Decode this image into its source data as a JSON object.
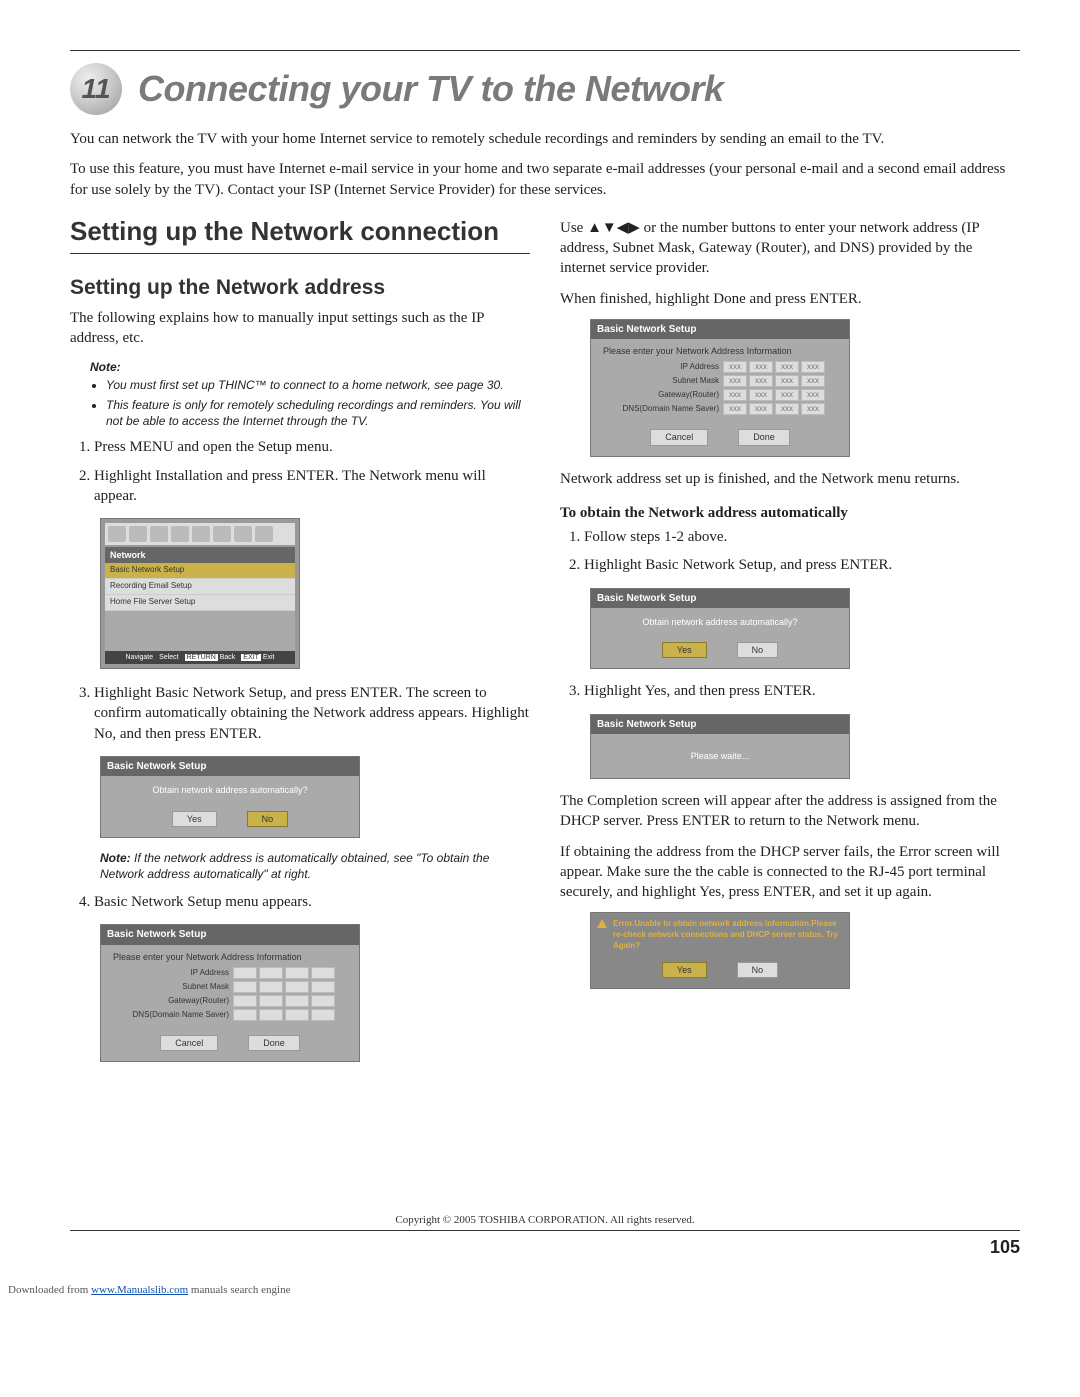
{
  "chapter": {
    "number": "11",
    "title": "Connecting your TV to the Network"
  },
  "intro": {
    "p1": "You can network the TV with your home Internet service to remotely schedule recordings and reminders by sending an email to the TV.",
    "p2": "To use this feature, you must have Internet e-mail service in your home and two separate e-mail addresses (your personal e-mail and a second email address for use solely by the TV). Contact your ISP (Internet Service Provider) for these services."
  },
  "left": {
    "h1": "Setting up the Network connection",
    "h2": "Setting up the Network address",
    "p_lead": "The following explains how to manually input settings such as the IP address, etc.",
    "note_label": "Note:",
    "note_items": [
      "You must first set up THINC™ to connect to a home network, see page 30.",
      "This feature is only for remotely scheduling recordings and reminders. You will not be able to access the Internet through the TV."
    ],
    "ol1": "Press MENU and open the Setup menu.",
    "ol2": "Highlight Installation and press ENTER. The Network menu will appear.",
    "ol3": "Highlight Basic Network Setup, and press ENTER. The screen to confirm automatically obtaining the Network address appears. Highlight No, and then press ENTER.",
    "inline_note_label": "Note:",
    "inline_note": " If the network address is automatically obtained, see \"To obtain the Network address automatically\" at right.",
    "ol4": "Basic Network Setup menu appears."
  },
  "right": {
    "p1": "Use ▲▼◀▶ or the number buttons to enter your network address (IP address, Subnet Mask, Gateway (Router), and DNS) provided by the internet service provider.",
    "p2": "When finished, highlight Done and press ENTER.",
    "p3": "Network address set up is finished, and the Network menu returns.",
    "sub": "To obtain the Network address automatically",
    "ol1": "Follow steps 1-2 above.",
    "ol2": "Highlight Basic Network Setup, and press ENTER.",
    "ol3": "Highlight Yes, and then press ENTER.",
    "p4": "The Completion screen will appear after the address is assigned from the DHCP server. Press ENTER to return to the Network menu.",
    "p5": "If obtaining the address from the DHCP server fails, the Error screen will appear. Make sure the the cable is connected to the RJ-45 port terminal securely, and highlight Yes, press ENTER, and set it up again."
  },
  "osd": {
    "net_title": "Network",
    "net_items": [
      "Basic Network Setup",
      "Recording Email Setup",
      "Home File Server Setup"
    ],
    "net_nav": [
      "Navigate",
      "Select",
      "Back",
      "Exit"
    ],
    "net_nav_back": "RETURN",
    "net_nav_exit": "EXIT",
    "bns_title": "Basic Network Setup",
    "auto_q": "Obtain network address automatically?",
    "yes": "Yes",
    "no": "No",
    "addr_heading": "Please enter your Network Address Information",
    "addr_fields": [
      "IP Address",
      "Subnet Mask",
      "Gateway(Router)",
      "DNS(Domain Name Saver)"
    ],
    "cancel": "Cancel",
    "done": "Done",
    "xxx": "xxx",
    "wait": "Please waite...",
    "error_text": "Error.Unable to obtain network address information.Please re-check network connections and DHCP server status. Try Again?"
  },
  "copyright": "Copyright © 2005 TOSHIBA CORPORATION. All rights reserved.",
  "page_number": "105",
  "download": {
    "prefix": "Downloaded from ",
    "link": "www.Manualslib.com",
    "suffix": " manuals search engine"
  }
}
